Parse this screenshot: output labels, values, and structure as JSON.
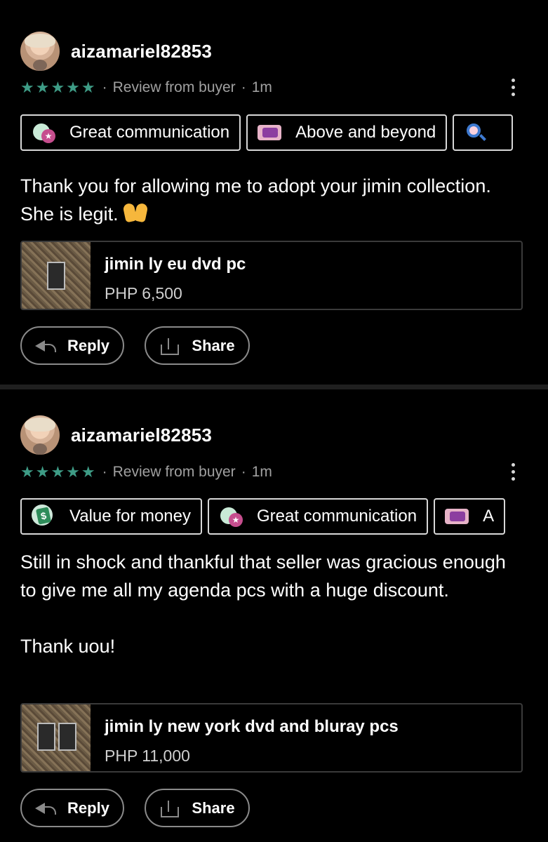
{
  "reviews": [
    {
      "username": "aizamariel82853",
      "stars": "★★★★★",
      "review_type": "Review from buyer",
      "time": "1m",
      "chips": [
        {
          "label": "Great communication",
          "icon": "great-communication-icon"
        },
        {
          "label": "Above and beyond",
          "icon": "above-and-beyond-icon"
        },
        {
          "label": "",
          "icon": "search-badge-icon"
        }
      ],
      "text": "Thank you  for allowing me to adopt your jimin collection. She is legit.",
      "product": {
        "title": "jimin ly eu dvd pc",
        "price": "PHP 6,500"
      },
      "reply_label": "Reply",
      "share_label": "Share"
    },
    {
      "username": "aizamariel82853",
      "stars": "★★★★★",
      "review_type": "Review from buyer",
      "time": "1m",
      "chips": [
        {
          "label": "Value for money",
          "icon": "value-for-money-icon"
        },
        {
          "label": "Great communication",
          "icon": "great-communication-icon"
        },
        {
          "label": "A",
          "icon": "above-and-beyond-icon"
        }
      ],
      "text": "Still in shock and thankful that seller was gracious enough to give me all my agenda pcs with a huge discount.\n\nThank uou!",
      "product": {
        "title": "jimin ly new york dvd and bluray pcs",
        "price": "PHP 11,000"
      },
      "reply_label": "Reply",
      "share_label": "Share"
    }
  ],
  "separator": "·",
  "colors": {
    "background": "#000000",
    "star": "#3e9c86",
    "divider": "#1f1f1f",
    "chip_border": "#d8d8d8"
  }
}
